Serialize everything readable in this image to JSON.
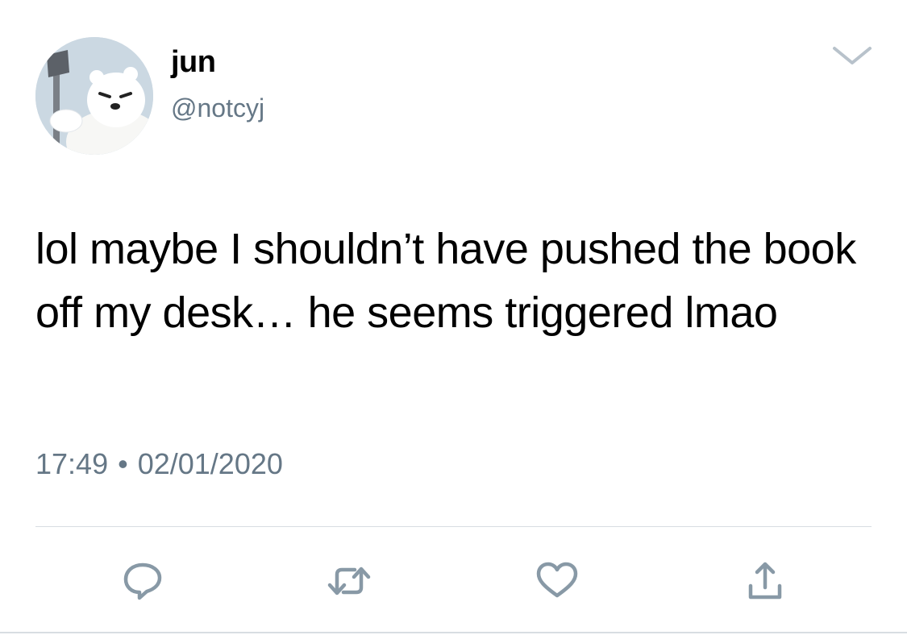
{
  "tweet": {
    "author": {
      "display_name": "jun",
      "handle": "@notcyj",
      "avatar_icon": "polar-bear-with-axe-avatar"
    },
    "menu_icon": "chevron-down-icon",
    "text": "lol maybe I shouldn’t have pushed the book off my desk… he seems triggered lmao",
    "time": "17:49",
    "separator": "•",
    "date": "02/01/2020",
    "actions": [
      {
        "name": "reply",
        "icon": "reply-icon"
      },
      {
        "name": "retweet",
        "icon": "retweet-icon"
      },
      {
        "name": "like",
        "icon": "heart-icon"
      },
      {
        "name": "share",
        "icon": "share-icon"
      }
    ]
  },
  "colors": {
    "text": "#000000",
    "secondary": "#657786",
    "divider": "#d8dde2",
    "icon": "#8899a6"
  }
}
